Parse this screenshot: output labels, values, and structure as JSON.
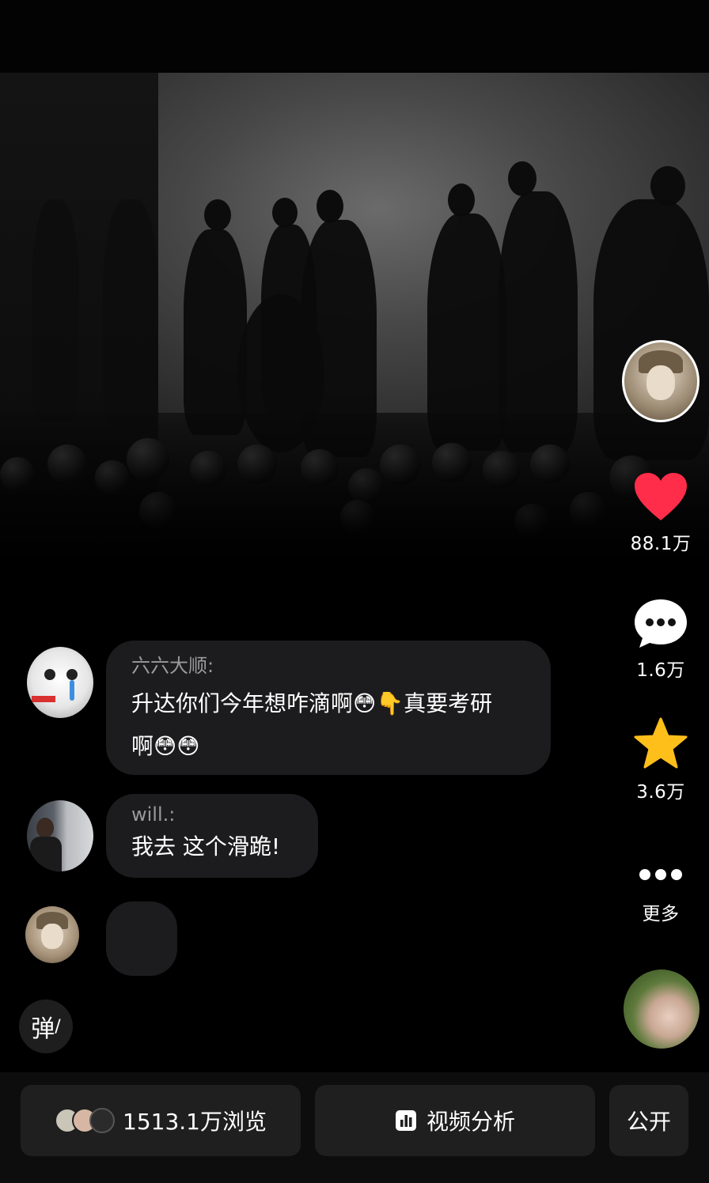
{
  "side": {
    "like_count": "88.1万",
    "comment_count": "1.6万",
    "favorite_count": "3.6万",
    "more_label": "更多"
  },
  "comments": [
    {
      "name": "六六大顺:",
      "line1": "升达你们今年想咋滴啊",
      "emoji1": "😳👇",
      "line1b": "真要考研",
      "line2": "啊",
      "emoji2": "😳😳"
    },
    {
      "name": "will.:",
      "line1": "我去 这个滑跪!"
    }
  ],
  "danmu_label": "弹",
  "bottom": {
    "views": "1513.1万浏览",
    "analysis": "视频分析",
    "public": "公开"
  },
  "colors": {
    "like": "#ff2d4a",
    "star": "#ffbf1a",
    "bubble": "#1c1c1e"
  }
}
